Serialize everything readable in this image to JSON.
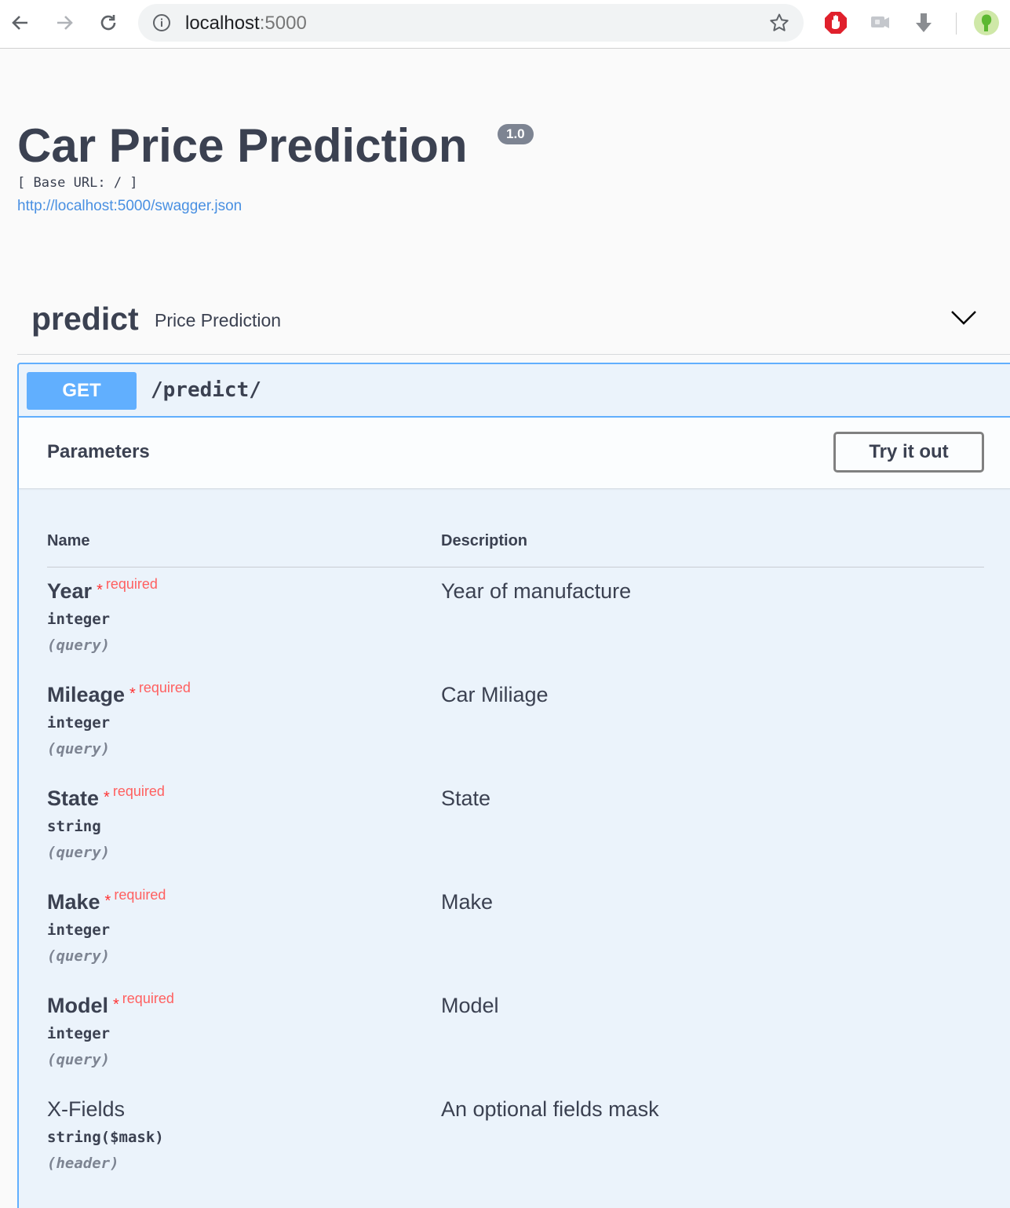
{
  "browser": {
    "url_host": "localhost",
    "url_port": ":5000"
  },
  "info": {
    "title": "Car Price Prediction",
    "version": "1.0",
    "base_url": "[ Base URL: / ]",
    "spec_link": "http://localhost:5000/swagger.json"
  },
  "tag": {
    "name": "predict",
    "description": "Price Prediction"
  },
  "operation": {
    "method": "GET",
    "path": "/predict/",
    "parameters_title": "Parameters",
    "try_it_out_label": "Try it out",
    "col_name": "Name",
    "col_description": "Description",
    "required_star": "*",
    "required_label": "required",
    "params": [
      {
        "name": "Year",
        "type": "integer",
        "in": "(query)",
        "description": "Year of manufacture",
        "required": true
      },
      {
        "name": "Mileage",
        "type": "integer",
        "in": "(query)",
        "description": "Car Miliage",
        "required": true
      },
      {
        "name": "State",
        "type": "string",
        "in": "(query)",
        "description": "State",
        "required": true
      },
      {
        "name": "Make",
        "type": "integer",
        "in": "(query)",
        "description": "Make",
        "required": true
      },
      {
        "name": "Model",
        "type": "integer",
        "in": "(query)",
        "description": "Model",
        "required": true
      },
      {
        "name": "X-Fields",
        "type": "string($mask)",
        "in": "(header)",
        "description": "An optional fields mask",
        "required": false
      }
    ]
  },
  "colors": {
    "get_blue": "#61affe",
    "op_background": "#ebf3fb",
    "text_dark": "#3b4151",
    "required_red": "#ff6060",
    "link_blue": "#4990e2"
  },
  "icons": [
    "back-arrow-icon",
    "forward-arrow-icon",
    "reload-icon",
    "info-icon",
    "star-icon",
    "stop-hand-icon",
    "chat-extension-icon",
    "download-arrow-icon",
    "profile-avatar-icon",
    "chevron-down-icon"
  ]
}
